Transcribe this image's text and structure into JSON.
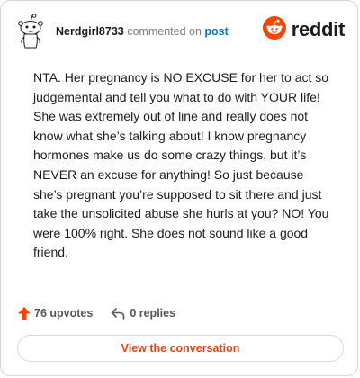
{
  "comment": {
    "username": "Nerdgirl8733",
    "action_text": "commented on",
    "target_link": "post",
    "body": "NTA. Her pregnancy is NO EXCUSE for her to act so judgemental and tell you what to do with YOUR life! She was extremely out of line and really does not know what she’s talking about! I know pregnancy hormones make us do some crazy things, but it’s NEVER an excuse for anything! So just because she’s pregnant you’re supposed to sit there and just take the unsolicited abuse she hurls at you? NO! You were 100% right. She does not sound like a good friend."
  },
  "brand": {
    "wordmark": "reddit",
    "icon": "reddit-logo-icon",
    "color": "#ff4500"
  },
  "avatar": {
    "icon": "snoo-avatar-icon"
  },
  "stats": {
    "upvotes_label": "76 upvotes",
    "replies_label": "0 replies",
    "upvote_icon": "upvote-arrow-icon",
    "reply_icon": "reply-arrow-icon",
    "upvote_color": "#ff4500"
  },
  "cta": {
    "label": "View the conversation",
    "color": "#d6461a"
  }
}
